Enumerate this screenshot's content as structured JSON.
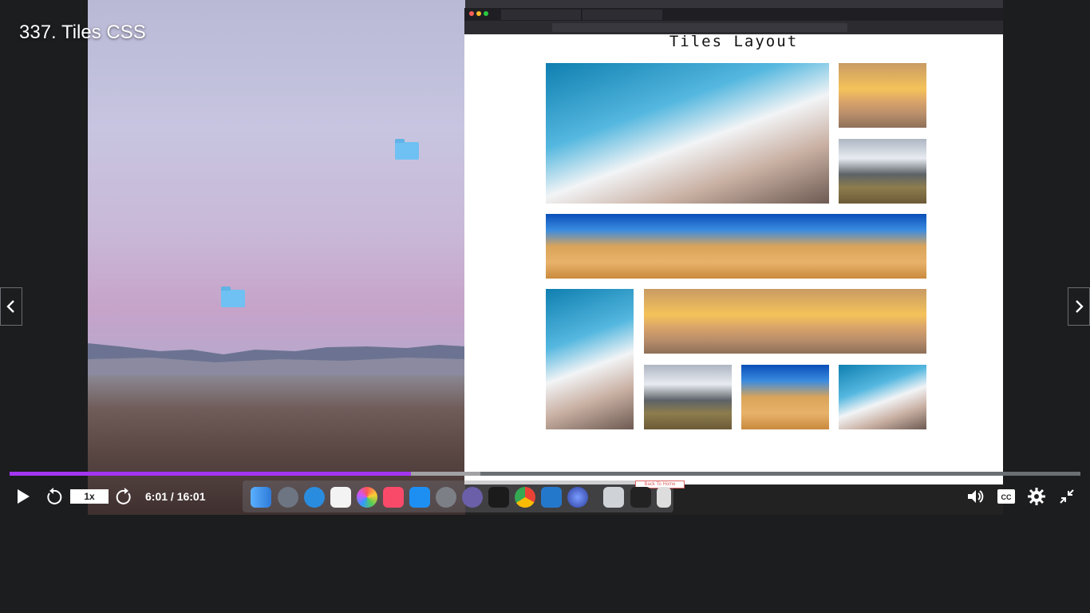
{
  "video": {
    "title": "337. Tiles CSS",
    "progress_fraction": 0.375,
    "buffer_fraction": 0.44,
    "current_time": "6:01",
    "duration": "16:01",
    "time_label": "6:01 / 16:01",
    "speed_label": "1x",
    "accent_color": "#a435f0"
  },
  "nav": {
    "prev_icon": "chevron-left-icon",
    "next_icon": "chevron-right-icon"
  },
  "controls": {
    "play_icon": "play-icon",
    "rewind_icon": "rewind-5-icon",
    "forward_icon": "forward-5-icon",
    "volume_icon": "volume-icon",
    "captions_icon": "closed-captions-icon",
    "settings_icon": "gear-icon",
    "exit_fullscreen_icon": "exit-fullscreen-icon"
  },
  "embedded_screen": {
    "page_heading": "Tiles Layout",
    "back_button": "Back To Home"
  }
}
